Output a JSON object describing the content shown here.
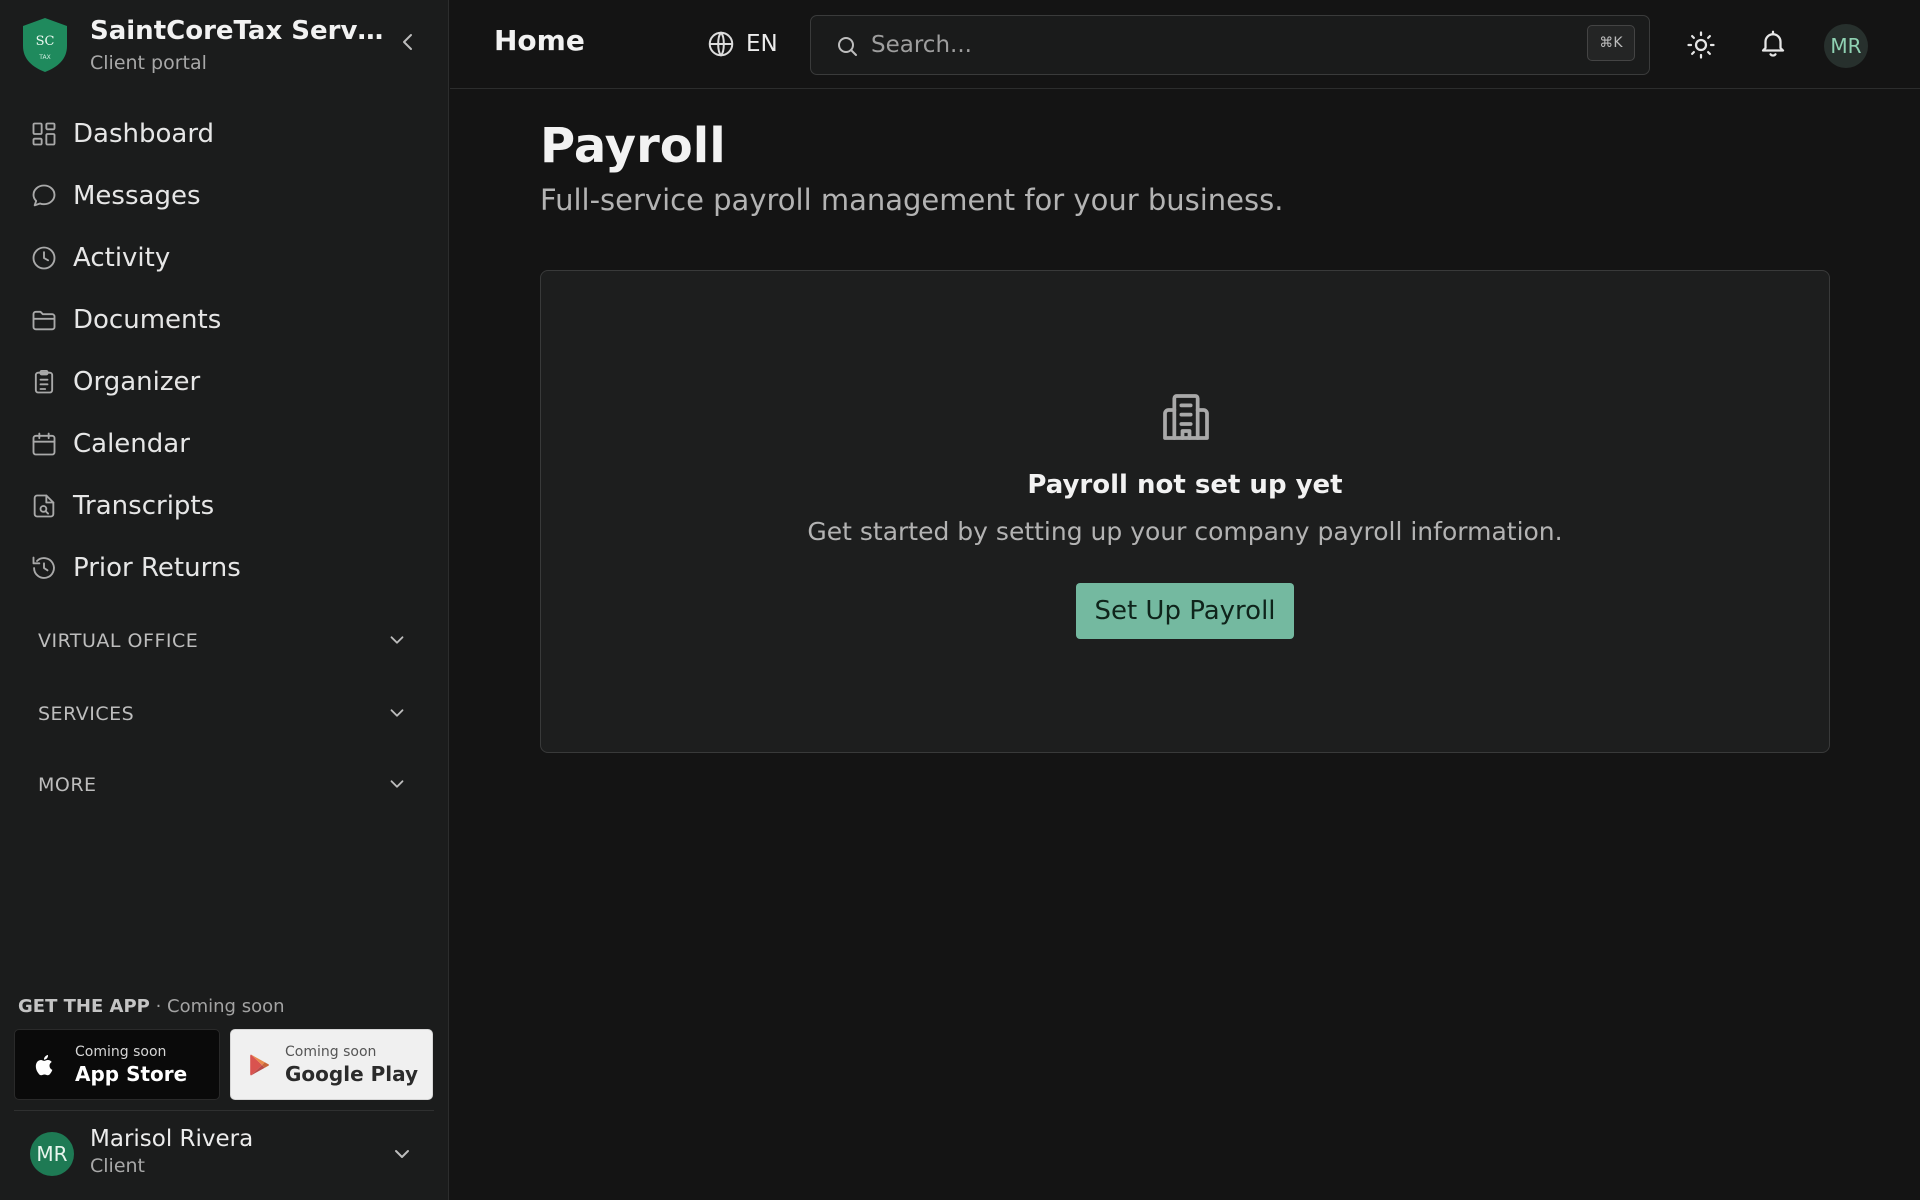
{
  "colors": {
    "background": "#141414",
    "sidebar": "#1b1c1c",
    "accent": "#74b9a0",
    "brand_green": "#1e7a54"
  },
  "brand": {
    "logo_text": "SC",
    "logo_subtext": "TAX",
    "name": "SaintCoreTax Services",
    "subtitle": "Client portal"
  },
  "sidebar": {
    "collapse_icon": "chevron-left-icon",
    "items": [
      {
        "label": "Dashboard",
        "icon": "dashboard-icon"
      },
      {
        "label": "Messages",
        "icon": "message-icon"
      },
      {
        "label": "Activity",
        "icon": "clock-icon"
      },
      {
        "label": "Documents",
        "icon": "folder-icon"
      },
      {
        "label": "Organizer",
        "icon": "clipboard-icon"
      },
      {
        "label": "Calendar",
        "icon": "calendar-icon"
      },
      {
        "label": "Transcripts",
        "icon": "file-search-icon"
      },
      {
        "label": "Prior Returns",
        "icon": "history-icon"
      }
    ],
    "sections": [
      {
        "label": "VIRTUAL OFFICE"
      },
      {
        "label": "SERVICES"
      },
      {
        "label": "MORE"
      }
    ],
    "get_app": {
      "heading": "GET THE APP",
      "status": "· Coming soon",
      "apple": {
        "small": "Coming soon",
        "big": "App Store"
      },
      "google": {
        "small": "Coming soon",
        "big": "Google Play"
      }
    },
    "user": {
      "initials": "MR",
      "name": "Marisol Rivera",
      "role": "Client"
    }
  },
  "header": {
    "title": "Home",
    "language": "EN",
    "search": {
      "placeholder": "Search...",
      "shortcut": "⌘K"
    },
    "avatar_initials": "MR"
  },
  "main": {
    "title": "Payroll",
    "subtitle": "Full-service payroll management for your business.",
    "empty_state": {
      "icon": "building-icon",
      "title": "Payroll not set up yet",
      "text": "Get started by setting up your company payroll information.",
      "button": "Set Up Payroll"
    }
  }
}
